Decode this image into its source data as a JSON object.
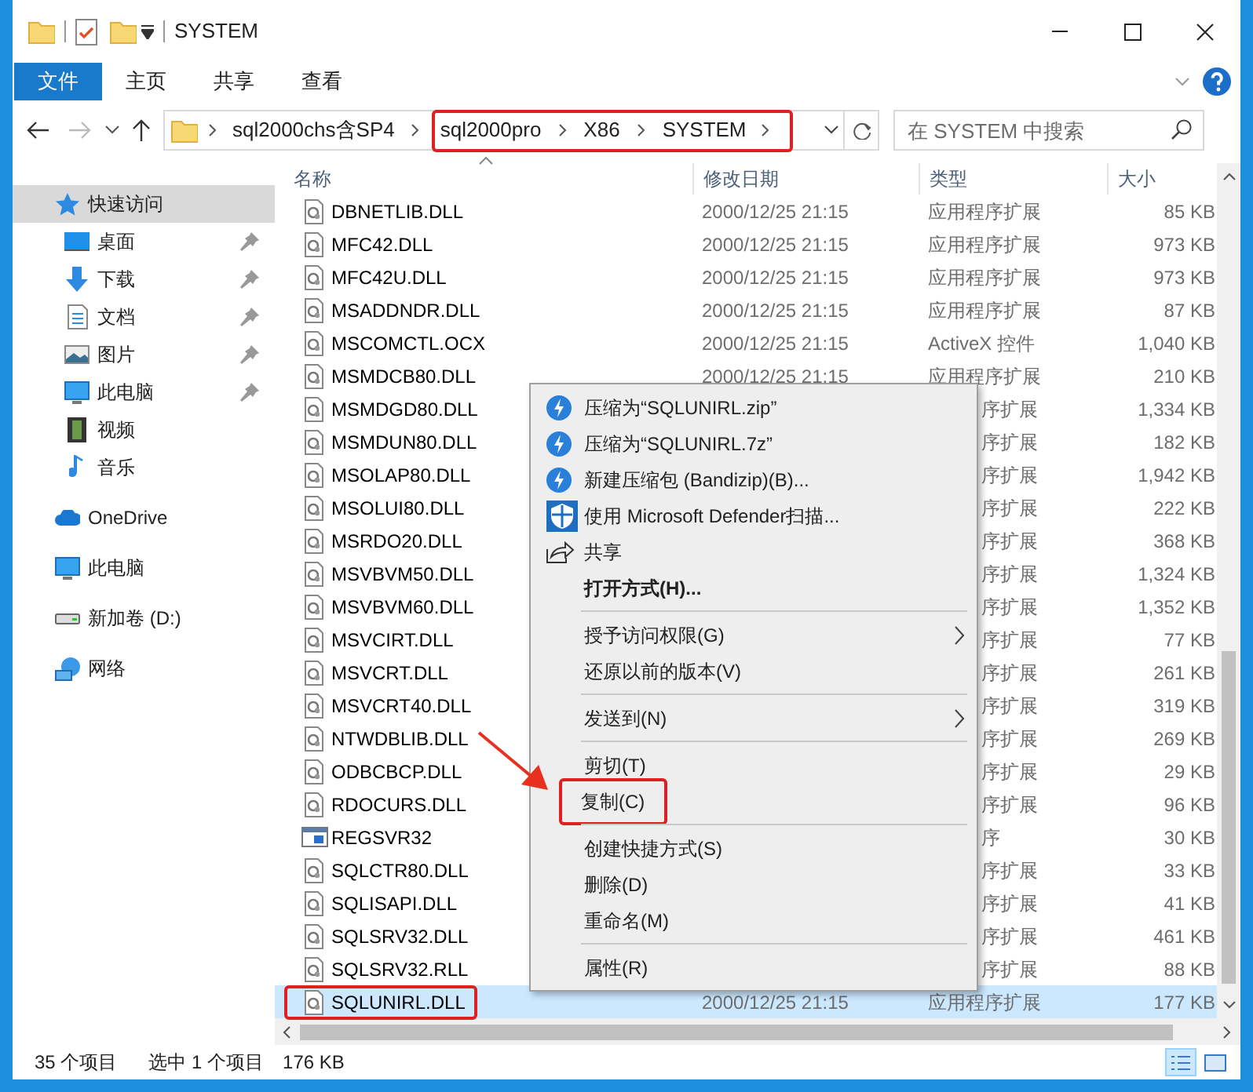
{
  "window": {
    "title": "SYSTEM"
  },
  "ribbon": {
    "file_button": "文件",
    "tabs": [
      "主页",
      "共享",
      "查看"
    ]
  },
  "address": {
    "crumbs": [
      {
        "label": "sql2000chs含SP4",
        "highlighted": false
      },
      {
        "label": "sql2000pro",
        "highlighted": true
      },
      {
        "label": "X86",
        "highlighted": true
      },
      {
        "label": "SYSTEM",
        "highlighted": true
      }
    ]
  },
  "search": {
    "placeholder": "在 SYSTEM 中搜索"
  },
  "navigation": [
    {
      "label": "快速访问",
      "kind": "star",
      "selected": true,
      "children": [
        {
          "label": "桌面",
          "kind": "desktop",
          "pinned": true
        },
        {
          "label": "下载",
          "kind": "download",
          "pinned": true
        },
        {
          "label": "文档",
          "kind": "document",
          "pinned": true
        },
        {
          "label": "图片",
          "kind": "pictures",
          "pinned": true
        },
        {
          "label": "此电脑",
          "kind": "computer",
          "pinned": true
        },
        {
          "label": "视频",
          "kind": "video",
          "pinned": false
        },
        {
          "label": "音乐",
          "kind": "music",
          "pinned": false
        }
      ]
    },
    {
      "label": "OneDrive",
      "kind": "cloud",
      "selected": false
    },
    {
      "label": "此电脑",
      "kind": "computer",
      "selected": false
    },
    {
      "label": "新加卷 (D:)",
      "kind": "drive",
      "selected": false
    },
    {
      "label": "网络",
      "kind": "network",
      "selected": false
    }
  ],
  "columns": [
    {
      "label": "名称",
      "sorted": true
    },
    {
      "label": "修改日期",
      "sorted": false
    },
    {
      "label": "类型",
      "sorted": false
    },
    {
      "label": "大小",
      "sorted": false
    }
  ],
  "rows": [
    {
      "kind": "dll",
      "name": "DBNETLIB.DLL",
      "date": "2000/12/25 21:15",
      "type": "应用程序扩展",
      "size": "85 KB",
      "selected": false,
      "highlighted": false
    },
    {
      "kind": "dll",
      "name": "MFC42.DLL",
      "date": "2000/12/25 21:15",
      "type": "应用程序扩展",
      "size": "973 KB",
      "selected": false,
      "highlighted": false
    },
    {
      "kind": "dll",
      "name": "MFC42U.DLL",
      "date": "2000/12/25 21:15",
      "type": "应用程序扩展",
      "size": "973 KB",
      "selected": false,
      "highlighted": false
    },
    {
      "kind": "dll",
      "name": "MSADDNDR.DLL",
      "date": "2000/12/25 21:15",
      "type": "应用程序扩展",
      "size": "87 KB",
      "selected": false,
      "highlighted": false
    },
    {
      "kind": "dll",
      "name": "MSCOMCTL.OCX",
      "date": "2000/12/25 21:15",
      "type": "ActiveX 控件",
      "size": "1,040 KB",
      "selected": false,
      "highlighted": false
    },
    {
      "kind": "dll",
      "name": "MSMDCB80.DLL",
      "date": "2000/12/25 21:15",
      "type": "应用程序扩展",
      "size": "210 KB",
      "selected": false,
      "highlighted": false
    },
    {
      "kind": "dll",
      "name": "MSMDGD80.DLL",
      "type": "序扩展",
      "size": "1,334 KB",
      "selected": false,
      "highlighted": false
    },
    {
      "kind": "dll",
      "name": "MSMDUN80.DLL",
      "type": "序扩展",
      "size": "182 KB",
      "selected": false,
      "highlighted": false
    },
    {
      "kind": "dll",
      "name": "MSOLAP80.DLL",
      "type": "序扩展",
      "size": "1,942 KB",
      "selected": false,
      "highlighted": false
    },
    {
      "kind": "dll",
      "name": "MSOLUI80.DLL",
      "type": "序扩展",
      "size": "222 KB",
      "selected": false,
      "highlighted": false
    },
    {
      "kind": "dll",
      "name": "MSRDO20.DLL",
      "type": "序扩展",
      "size": "368 KB",
      "selected": false,
      "highlighted": false
    },
    {
      "kind": "dll",
      "name": "MSVBVM50.DLL",
      "type": "序扩展",
      "size": "1,324 KB",
      "selected": false,
      "highlighted": false
    },
    {
      "kind": "dll",
      "name": "MSVBVM60.DLL",
      "type": "序扩展",
      "size": "1,352 KB",
      "selected": false,
      "highlighted": false
    },
    {
      "kind": "dll",
      "name": "MSVCIRT.DLL",
      "type": "序扩展",
      "size": "77 KB",
      "selected": false,
      "highlighted": false
    },
    {
      "kind": "dll",
      "name": "MSVCRT.DLL",
      "type": "序扩展",
      "size": "261 KB",
      "selected": false,
      "highlighted": false
    },
    {
      "kind": "dll",
      "name": "MSVCRT40.DLL",
      "type": "序扩展",
      "size": "319 KB",
      "selected": false,
      "highlighted": false
    },
    {
      "kind": "dll",
      "name": "NTWDBLIB.DLL",
      "type": "序扩展",
      "size": "269 KB",
      "selected": false,
      "highlighted": false
    },
    {
      "kind": "dll",
      "name": "ODBCBCP.DLL",
      "type": "序扩展",
      "size": "29 KB",
      "selected": false,
      "highlighted": false
    },
    {
      "kind": "dll",
      "name": "RDOCURS.DLL",
      "type": "序扩展",
      "size": "96 KB",
      "selected": false,
      "highlighted": false
    },
    {
      "kind": "exe",
      "name": "REGSVR32",
      "type": "序",
      "size": "30 KB",
      "selected": false,
      "highlighted": false
    },
    {
      "kind": "dll",
      "name": "SQLCTR80.DLL",
      "type": "序扩展",
      "size": "33 KB",
      "selected": false,
      "highlighted": false
    },
    {
      "kind": "dll",
      "name": "SQLISAPI.DLL",
      "type": "序扩展",
      "size": "41 KB",
      "selected": false,
      "highlighted": false
    },
    {
      "kind": "dll",
      "name": "SQLSRV32.DLL",
      "type": "序扩展",
      "size": "461 KB",
      "selected": false,
      "highlighted": false
    },
    {
      "kind": "dll",
      "name": "SQLSRV32.RLL",
      "type": "序扩展",
      "size": "88 KB",
      "selected": false,
      "highlighted": false
    },
    {
      "kind": "dll",
      "name": "SQLUNIRL.DLL",
      "date": "2000/12/25 21:15",
      "type": "应用程序扩展",
      "size": "177 KB",
      "selected": true,
      "highlighted": true
    }
  ],
  "context_menu": {
    "items": [
      {
        "kind": "bandizip",
        "label": "压缩为“SQLUNIRL.zip”",
        "bold": false,
        "submenu": false,
        "highlighted": false
      },
      {
        "kind": "bandizip",
        "label": "压缩为“SQLUNIRL.7z”",
        "bold": false,
        "submenu": false,
        "highlighted": false
      },
      {
        "kind": "bandizip",
        "label": "新建压缩包 (Bandizip)(B)...",
        "bold": false,
        "submenu": false,
        "highlighted": false
      },
      {
        "kind": "defender",
        "label": "使用 Microsoft Defender扫描...",
        "bold": false,
        "submenu": false,
        "highlighted": false
      },
      {
        "kind": "share",
        "label": "共享",
        "bold": false,
        "submenu": false,
        "highlighted": false
      },
      {
        "kind": "item",
        "label": "打开方式(H)...",
        "bold": true,
        "submenu": false,
        "highlighted": false
      },
      {
        "kind": "separator"
      },
      {
        "kind": "item",
        "label": "授予访问权限(G)",
        "bold": false,
        "submenu": true,
        "highlighted": false
      },
      {
        "kind": "item",
        "label": "还原以前的版本(V)",
        "bold": false,
        "submenu": false,
        "highlighted": false
      },
      {
        "kind": "separator"
      },
      {
        "kind": "item",
        "label": "发送到(N)",
        "bold": false,
        "submenu": true,
        "highlighted": false
      },
      {
        "kind": "separator"
      },
      {
        "kind": "item",
        "label": "剪切(T)",
        "bold": false,
        "submenu": false,
        "highlighted": false
      },
      {
        "kind": "item",
        "label": "复制(C)",
        "bold": false,
        "submenu": false,
        "highlighted": true
      },
      {
        "kind": "separator"
      },
      {
        "kind": "item",
        "label": "创建快捷方式(S)",
        "bold": false,
        "submenu": false,
        "highlighted": false
      },
      {
        "kind": "item",
        "label": "删除(D)",
        "bold": false,
        "submenu": false,
        "highlighted": false
      },
      {
        "kind": "item",
        "label": "重命名(M)",
        "bold": false,
        "submenu": false,
        "highlighted": false
      },
      {
        "kind": "separator"
      },
      {
        "kind": "item",
        "label": "属性(R)",
        "bold": false,
        "submenu": false,
        "highlighted": false
      }
    ]
  },
  "status_bar": {
    "item_count": "35 个项目",
    "selection": "选中 1 个项目",
    "selection_size": "176 KB",
    "views": [
      {
        "kind": "details",
        "selected": true
      },
      {
        "kind": "large_icons",
        "selected": false
      }
    ]
  }
}
